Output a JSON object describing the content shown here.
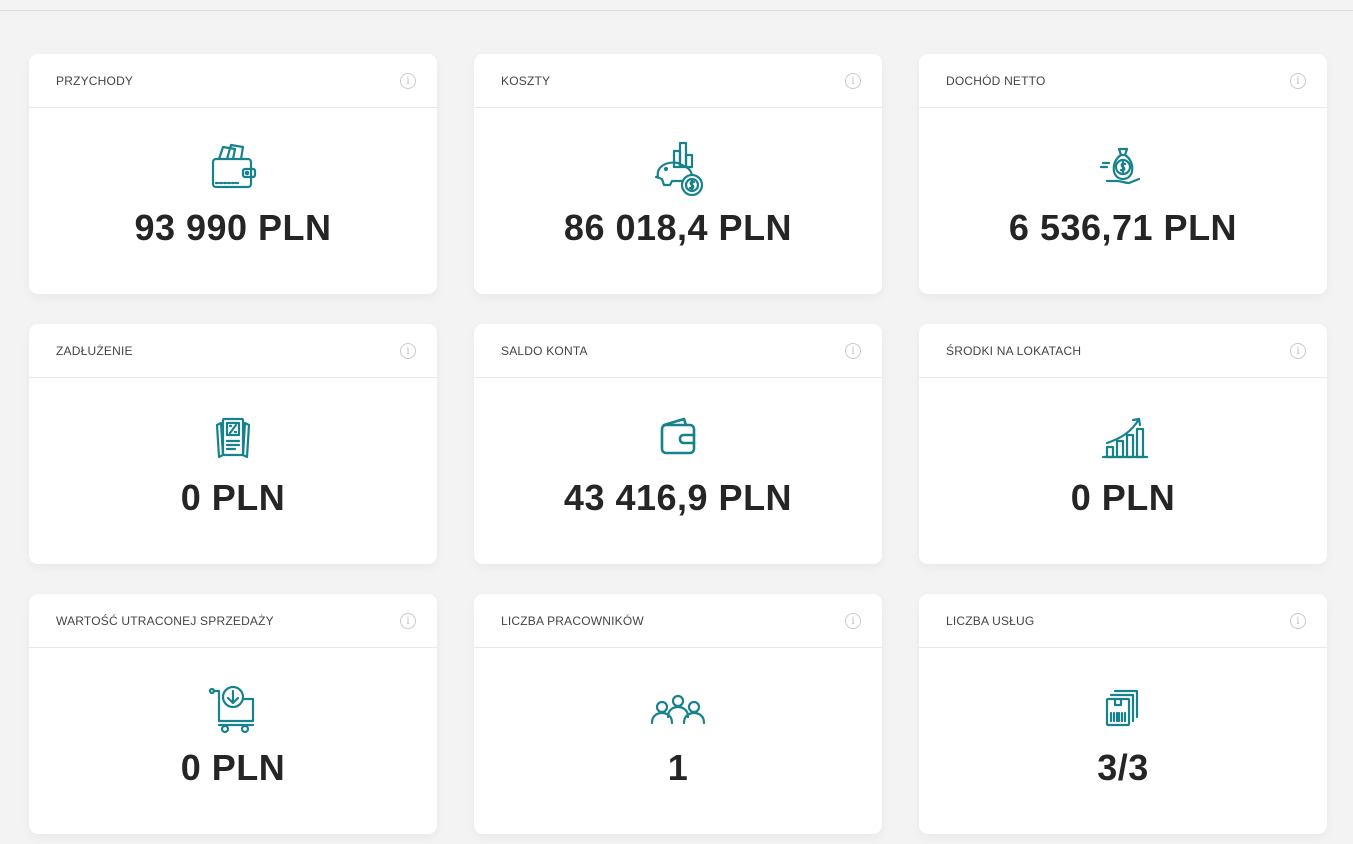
{
  "accent_color": "#17828c",
  "cards": [
    {
      "title": "PRZYCHODY",
      "value": "93 990 PLN",
      "icon": "wallet-cards-icon"
    },
    {
      "title": "KOSZTY",
      "value": "86 018,4 PLN",
      "icon": "piggy-bank-chart-icon"
    },
    {
      "title": "DOCHÓD NETTO",
      "value": "6 536,71 PLN",
      "icon": "money-bag-hand-icon"
    },
    {
      "title": "ZADŁUŻENIE",
      "value": "0 PLN",
      "icon": "percent-document-icon"
    },
    {
      "title": "SALDO KONTA",
      "value": "43 416,9 PLN",
      "icon": "wallet-icon"
    },
    {
      "title": "ŚRODKI NA LOKATACH",
      "value": "0 PLN",
      "icon": "growth-chart-icon"
    },
    {
      "title": "WARTOŚĆ UTRACONEJ SPRZEDAŻY",
      "value": "0 PLN",
      "icon": "cart-download-icon"
    },
    {
      "title": "LICZBA PRACOWNIKÓW",
      "value": "1",
      "icon": "people-group-icon"
    },
    {
      "title": "LICZBA USŁUG",
      "value": "3/3",
      "icon": "barcode-boxes-icon"
    }
  ],
  "info_glyph": "i"
}
